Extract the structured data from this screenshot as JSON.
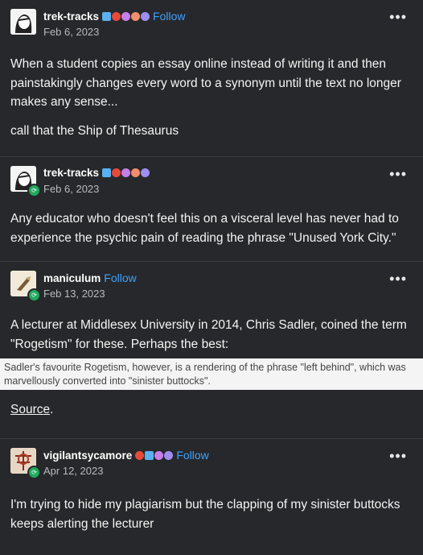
{
  "posts": [
    {
      "username": "trek-tracks",
      "follow_label": "Follow",
      "date": "Feb 6, 2023",
      "paragraphs": [
        "When a student copies an essay online instead of writing it and then painstakingly changes every word to a synonym until the text no longer makes any sense...",
        "call that the Ship of Thesaurus"
      ]
    },
    {
      "username": "trek-tracks",
      "date": "Feb 6, 2023",
      "paragraphs": [
        "Any educator who doesn't feel this on a visceral level has never had to experience the psychic pain of reading the phrase \"Unused York City.\""
      ]
    },
    {
      "username": "maniculum",
      "follow_label": "Follow",
      "date": "Feb 13, 2023",
      "paragraphs": [
        "A lecturer at Middlesex University in 2014, Chris Sadler, coined the term \"Rogetism\" for these. Perhaps the best:"
      ],
      "quote": "Sadler's favourite Rogetism, however, is a rendering of the phrase \"left behind\", which was marvellously converted into \"sinister buttocks\".",
      "source_link": "Source",
      "source_suffix": "."
    },
    {
      "username": "vigilantsycamore",
      "follow_label": "Follow",
      "date": "Apr 12, 2023",
      "paragraphs": [
        "I'm trying to hide my plagiarism but the clapping of my sinister buttocks keeps alerting the lecturer"
      ]
    }
  ],
  "menu_label": "•••",
  "colors": {
    "background": "#26282b",
    "follow": "#3fa2ff",
    "reblog_badge": "#21a95e"
  },
  "icons": {
    "menu": "more-dots-icon",
    "reblog": "reblog-icon"
  }
}
